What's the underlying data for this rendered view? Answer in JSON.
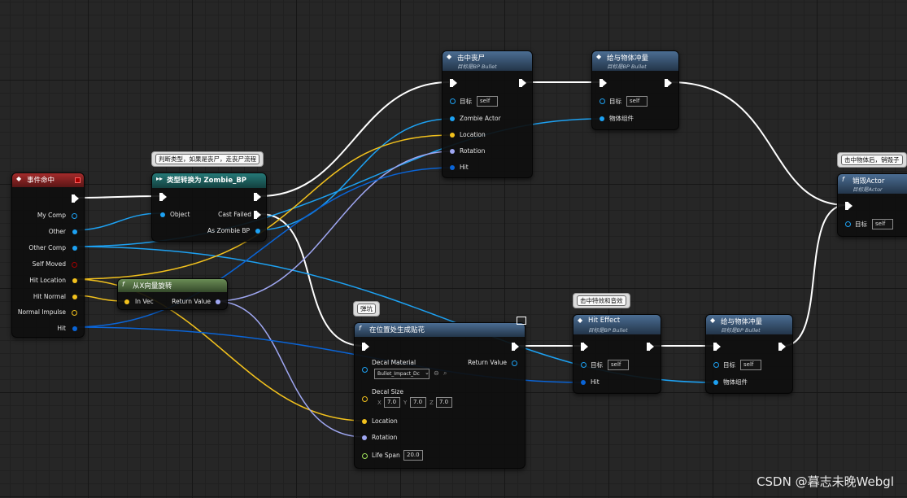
{
  "colors": {
    "exec": "#ffffff",
    "object": "#1da1f2",
    "vector": "#f2c11d",
    "rotator": "#9fa7f2",
    "struct": "#0a64d6",
    "bool": "#a00000",
    "float": "#9ee05a",
    "event_header": "#a42b2b",
    "function_header": "#4b6d93",
    "cast_header": "#267a78",
    "pure_header": "#6a8c55"
  },
  "event_node": {
    "title": "事件命中",
    "pins": [
      "My Comp",
      "Other",
      "Other Comp",
      "Self Moved",
      "Hit Location",
      "Hit Normal",
      "Normal Impulse",
      "Hit"
    ]
  },
  "comment_cast": "判断类型，如果是丧尸，走丧尸流程",
  "cast_node": {
    "title": "类型转换为 Zombie_BP",
    "object": "Object",
    "cast_failed": "Cast Failed",
    "as_zombie": "As Zombie BP"
  },
  "rot_node": {
    "title": "从X向量旋转",
    "in_vec": "In Vec",
    "return": "Return Value"
  },
  "zombie_node": {
    "title": "击中丧尸",
    "sub": "目标是BP Bullet",
    "target": "目标",
    "target_val": "self",
    "pins": [
      "Zombie Actor",
      "Location",
      "Rotation",
      "Hit"
    ]
  },
  "impulse1": {
    "title": "给与物体冲量",
    "sub": "目标是BP Bullet",
    "target": "目标",
    "target_val": "self",
    "comp": "物体组件"
  },
  "comment_destroy": "击中物体后，销毁子",
  "destroy_node": {
    "title": "销毁Actor",
    "sub": "目标是Actor",
    "target": "目标",
    "target_val": "self"
  },
  "comment_decal": "弹坑",
  "decal_node": {
    "title": "在位置处生成贴花",
    "decal_material": "Decal Material",
    "material_val": "Bullet_Impact_Dc",
    "return": "Return Value",
    "decal_size": "Decal Size",
    "x_label": "X",
    "x": "7.0",
    "y_label": "Y",
    "y": "7.0",
    "z_label": "Z",
    "z": "7.0",
    "location": "Location",
    "rotation": "Rotation",
    "life_span": "Life Span",
    "life_val": "20.0"
  },
  "comment_hit": "击中特效和音效",
  "hit_node": {
    "title": "Hit Effect",
    "sub": "目标是BP Bullet",
    "target": "目标",
    "target_val": "self",
    "hit": "Hit"
  },
  "impulse2": {
    "title": "给与物体冲量",
    "sub": "目标是BP Bullet",
    "target": "目标",
    "target_val": "self",
    "comp": "物体组件"
  },
  "watermark": "CSDN @暮志未晚Webgl"
}
